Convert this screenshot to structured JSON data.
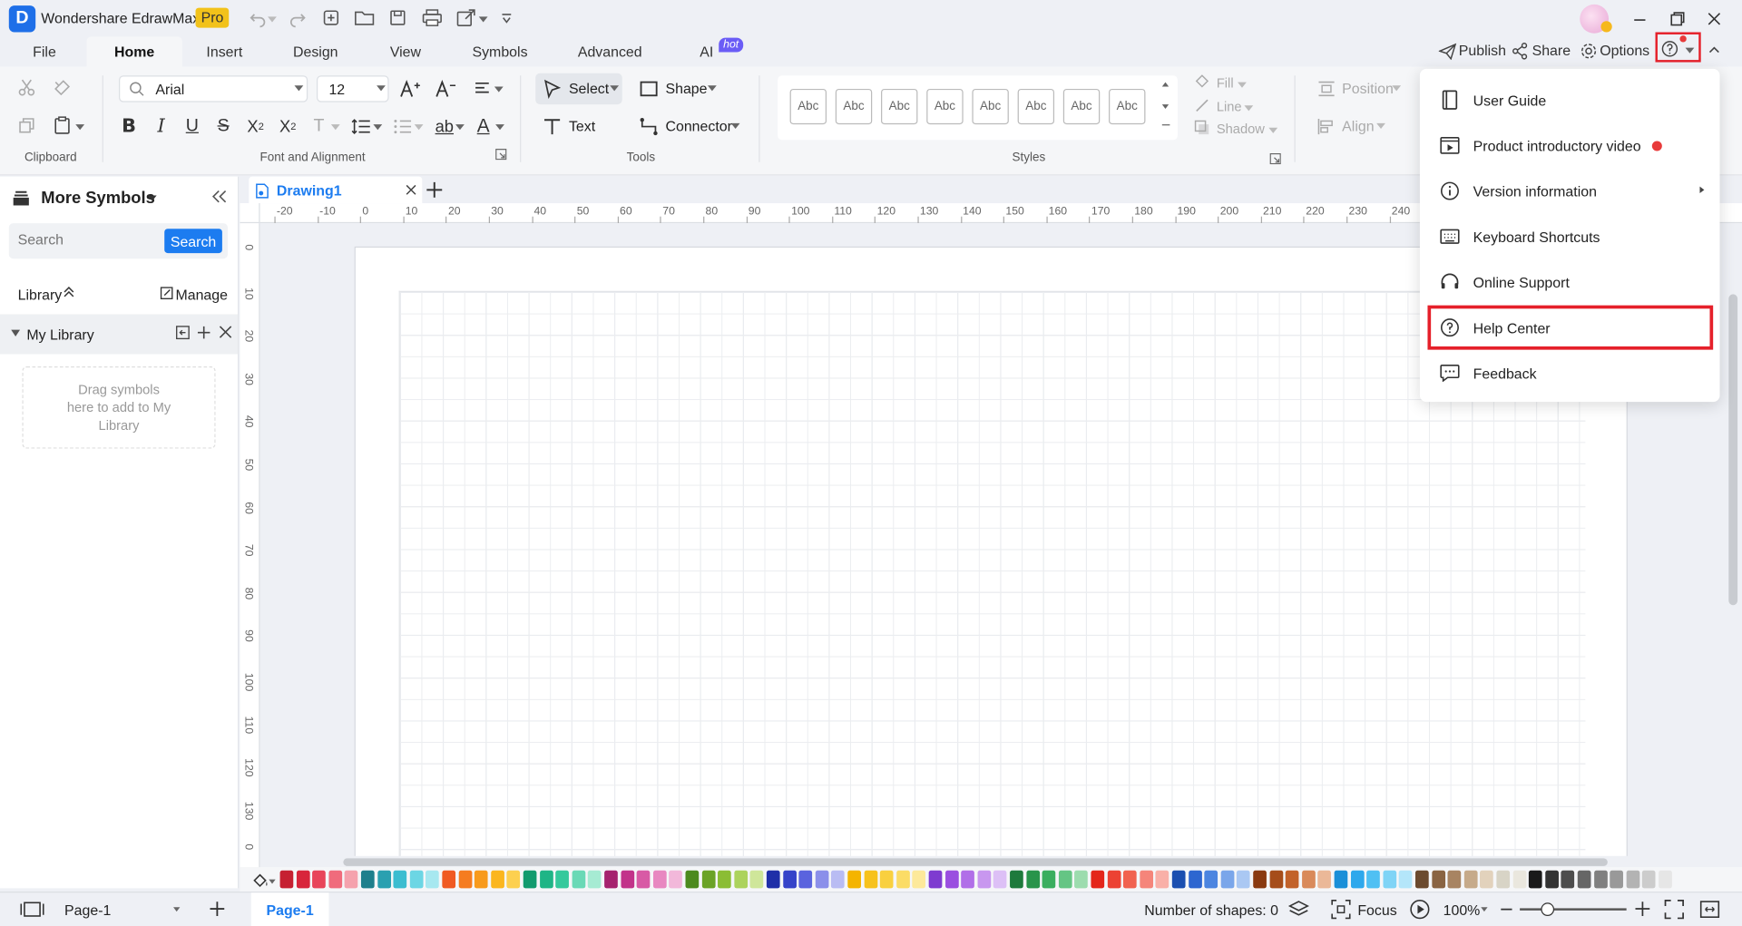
{
  "app": {
    "title": "Wondershare EdrawMax",
    "badge": "Pro"
  },
  "menu_tabs": [
    {
      "label": "File"
    },
    {
      "label": "Home"
    },
    {
      "label": "Insert"
    },
    {
      "label": "Design"
    },
    {
      "label": "View"
    },
    {
      "label": "Symbols"
    },
    {
      "label": "Advanced"
    },
    {
      "label": "AI"
    }
  ],
  "ai_badge": "hot",
  "top_actions": {
    "publish": "Publish",
    "share": "Share",
    "options": "Options"
  },
  "ribbon": {
    "font_name": "Arial",
    "font_size": "12",
    "select_label": "Select",
    "shape_label": "Shape",
    "text_label": "Text",
    "connector_label": "Connector",
    "style_samples": [
      "Abc",
      "Abc",
      "Abc",
      "Abc",
      "Abc",
      "Abc",
      "Abc",
      "Abc"
    ],
    "fill_label": "Fill",
    "line_label": "Line",
    "shadow_label": "Shadow",
    "position_label": "Position",
    "align_label": "Align",
    "groups": {
      "clipboard": "Clipboard",
      "font": "Font and Alignment",
      "tools": "Tools",
      "styles": "Styles"
    }
  },
  "sidebar": {
    "title": "More Symbols",
    "search_placeholder": "Search",
    "search_button": "Search",
    "library_label": "Library",
    "manage_label": "Manage",
    "my_library": "My Library",
    "drop_hint": "Drag symbols here to add to My Library"
  },
  "document_tab": {
    "name": "Drawing1"
  },
  "ruler": {
    "h_labels": [
      "-20",
      "-10",
      "0",
      "10",
      "20",
      "30",
      "40",
      "50",
      "60",
      "70",
      "80",
      "90",
      "100",
      "110",
      "120",
      "130",
      "140",
      "150",
      "160",
      "170",
      "180",
      "190",
      "200",
      "210",
      "220",
      "230",
      "240"
    ],
    "v_labels": [
      "0",
      "10",
      "20",
      "30",
      "40",
      "50",
      "60",
      "70",
      "80",
      "90",
      "100",
      "110",
      "120",
      "130",
      "0"
    ]
  },
  "help_menu": {
    "items": [
      {
        "label": "User Guide",
        "icon": "book-icon"
      },
      {
        "label": "Product introductory video",
        "icon": "video-icon"
      },
      {
        "label": "Version information",
        "icon": "info-icon"
      },
      {
        "label": "Keyboard Shortcuts",
        "icon": "keyboard-icon"
      },
      {
        "label": "Online Support",
        "icon": "headset-icon"
      },
      {
        "label": "Help Center",
        "icon": "help-circle-icon"
      },
      {
        "label": "Feedback",
        "icon": "feedback-icon"
      }
    ],
    "highlight_color": "#e5202a",
    "notice_dot_color": "#e83a3a"
  },
  "palette": [
    "#c62031",
    "#d8253b",
    "#e8455a",
    "#f06b7c",
    "#f5a2ad",
    "#1e7f8c",
    "#2aa0b0",
    "#3bbdd0",
    "#6cd6e4",
    "#a7e8f0",
    "#f05a22",
    "#f57c20",
    "#f89a1c",
    "#fbb61e",
    "#fdd04f",
    "#129b6e",
    "#1fb586",
    "#35c99c",
    "#6ad9b6",
    "#a6ebd3",
    "#a5236e",
    "#c2338a",
    "#d85aa5",
    "#e888c1",
    "#f2b8da",
    "#4c8a1e",
    "#6ba326",
    "#8bbd34",
    "#acd35c",
    "#cfe69a",
    "#1f2fa8",
    "#3543c9",
    "#5a63de",
    "#8b8fea",
    "#b9bcf3",
    "#f4b400",
    "#f7c21c",
    "#f9d03f",
    "#fbdc66",
    "#fde99b",
    "#7e3bd0",
    "#9a4ee0",
    "#b16fe8",
    "#c897ef",
    "#ddc0f6",
    "#1e7a3c",
    "#29944b",
    "#3aae5f",
    "#65c584",
    "#9cdcae",
    "#e4261a",
    "#ec4233",
    "#f1624f",
    "#f5857a",
    "#f9b0a8",
    "#1b4fb0",
    "#2d66d0",
    "#4c85e0",
    "#7aa6ea",
    "#aac8f3",
    "#8a3a10",
    "#a64d1a",
    "#c2622a",
    "#d98a5a",
    "#ebb898",
    "#1a8fd8",
    "#2ea8ec",
    "#4fc0f3",
    "#7fd4f6",
    "#b4e6fa",
    "#6b4a2e",
    "#8a6442",
    "#a88462",
    "#c6aa8a",
    "#e2d2bc",
    "#d8d4c6",
    "#eae7de",
    "#1a1a1a",
    "#333333",
    "#4d4d4d",
    "#666666",
    "#808080",
    "#999999",
    "#b3b3b3",
    "#cccccc",
    "#e6e6e6"
  ],
  "status": {
    "page_select": "Page-1",
    "page_tab": "Page-1",
    "shape_count": "Number of shapes: 0",
    "focus": "Focus",
    "zoom": "100%"
  }
}
